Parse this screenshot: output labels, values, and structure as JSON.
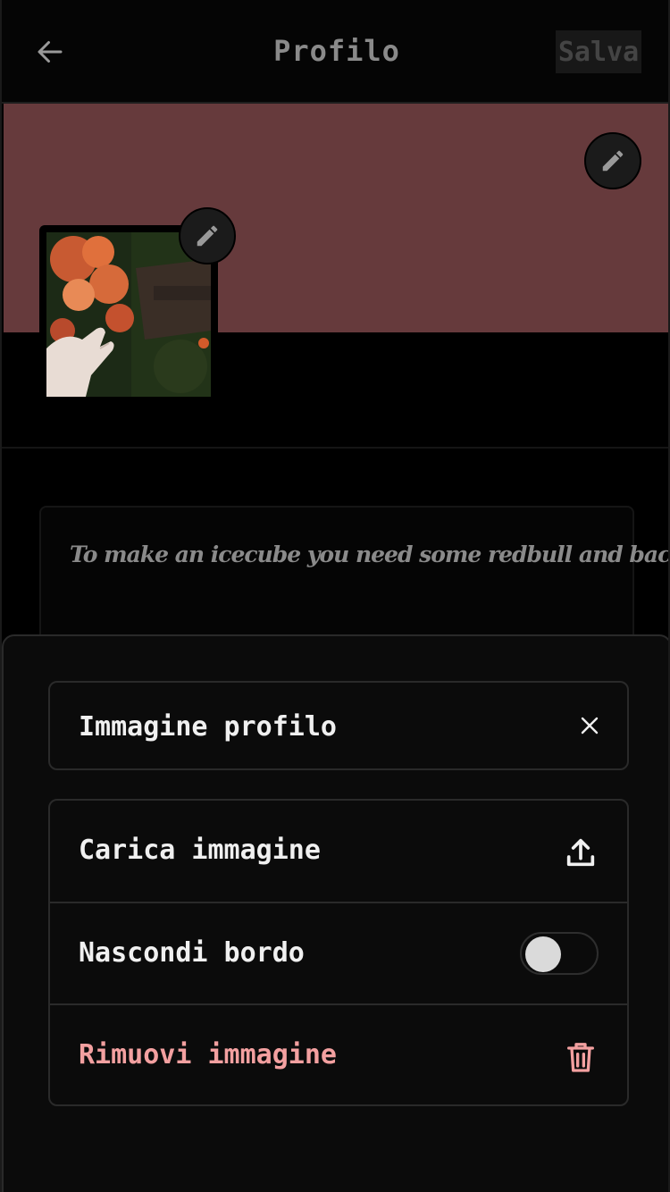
{
  "header": {
    "title": "Profilo",
    "save_label": "Salva",
    "back_icon": "arrow-left-icon"
  },
  "banner": {
    "color": "#663a3c",
    "edit_icon": "pencil-icon"
  },
  "avatar": {
    "edit_icon": "pencil-icon",
    "image": "photo of orange flowers and hand"
  },
  "bio": {
    "text": "To make an icecube you need some redbull and bach"
  },
  "sheet": {
    "title": "Immagine profilo",
    "close_icon": "close-icon",
    "options": [
      {
        "label": "Carica immagine",
        "icon": "upload-icon"
      },
      {
        "label": "Nascondi bordo",
        "toggle_on": false
      },
      {
        "label": "Rimuovi immagine",
        "icon": "trash-icon",
        "color": "#f3a0a0"
      }
    ]
  }
}
